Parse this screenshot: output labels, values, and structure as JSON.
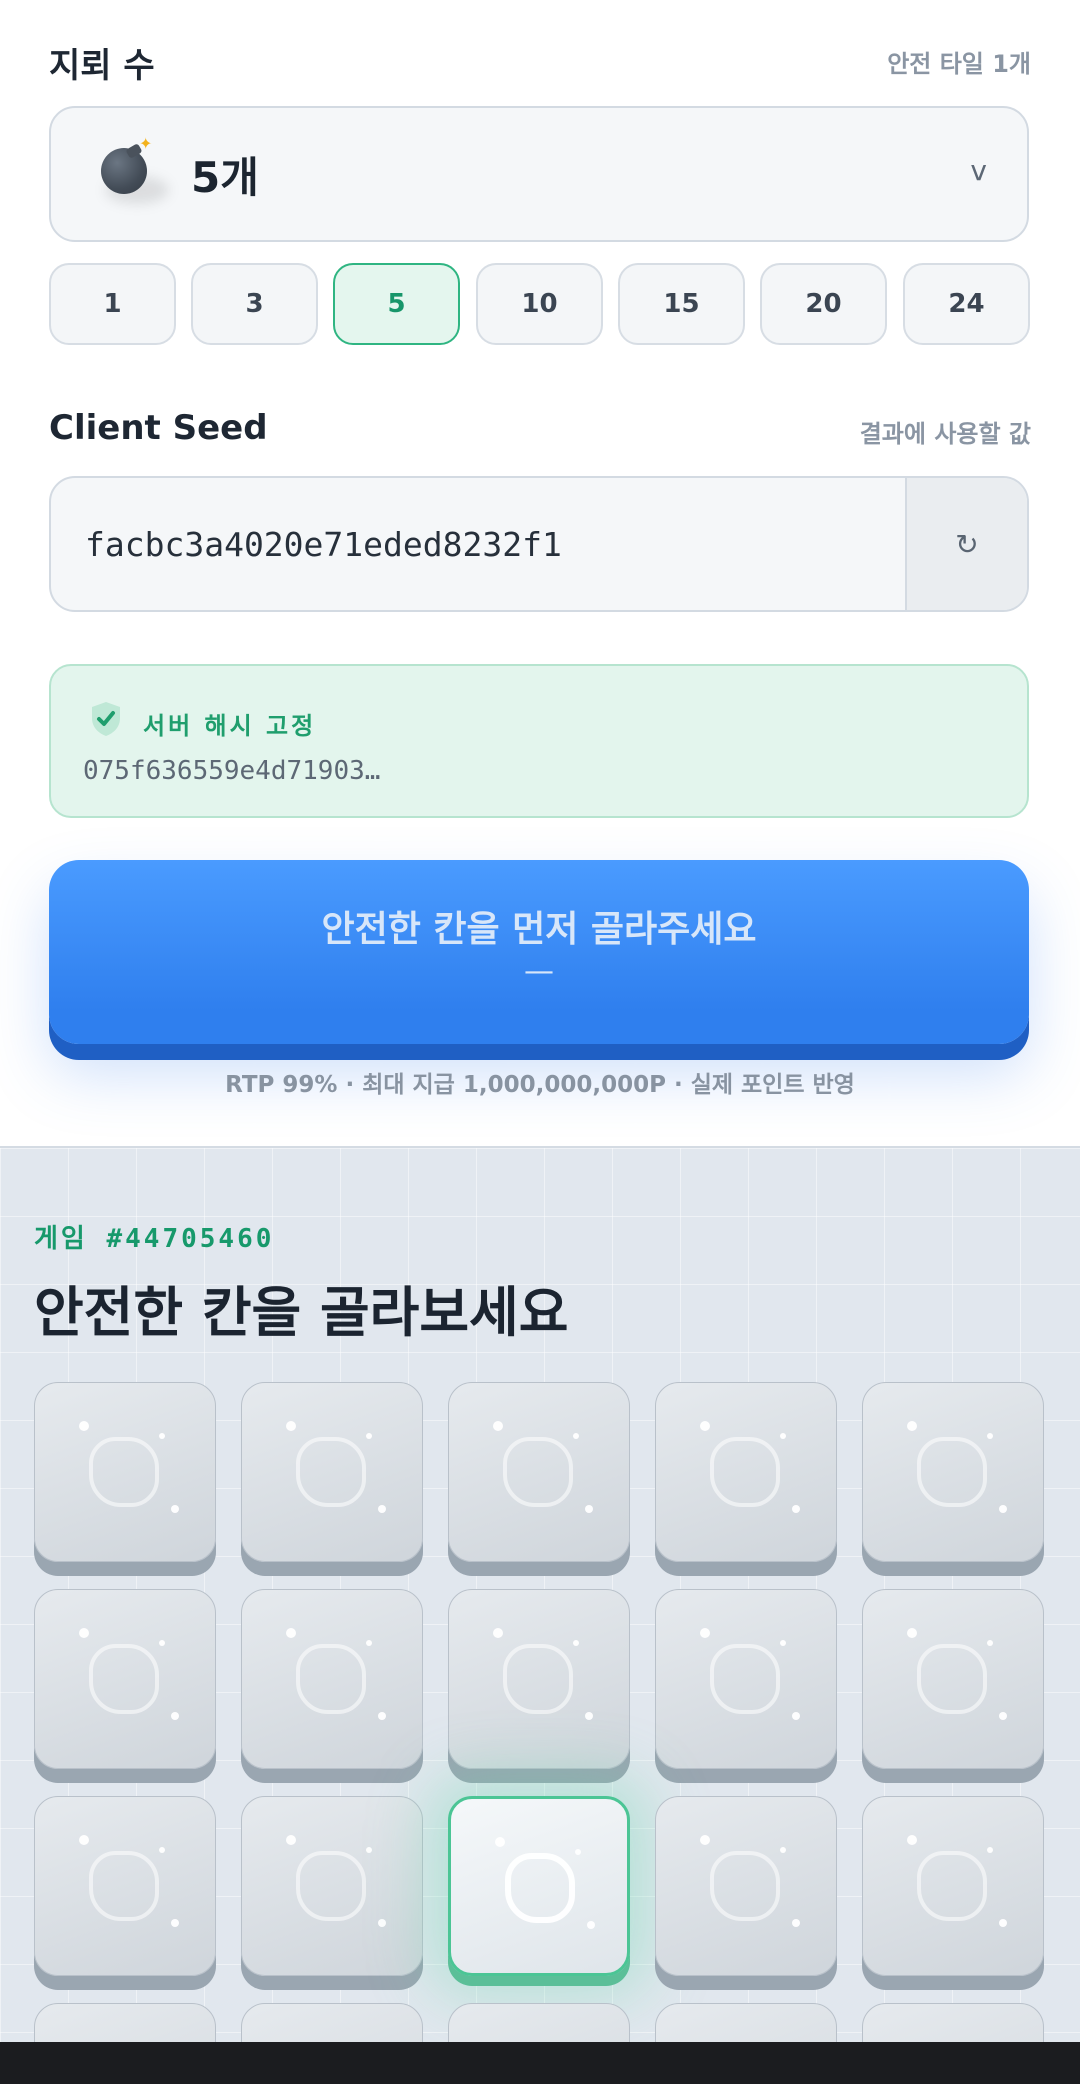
{
  "mines": {
    "title": "지뢰 수",
    "hint": "안전 타일 1개",
    "selected_label": "5개",
    "chevron": "v",
    "icon": "bomb-icon",
    "presets": [
      "1",
      "3",
      "5",
      "10",
      "15",
      "20",
      "24"
    ],
    "active_preset": "5"
  },
  "seed": {
    "title": "Client Seed",
    "hint": "결과에 사용할 값",
    "value": "facbc3a4020e71eded8232f1",
    "refresh_glyph": "↻"
  },
  "server_hash": {
    "label": "서버 해시 고정",
    "value": "075f636559e4d71903…",
    "icon": "shield-check-icon"
  },
  "cta": {
    "label": "안전한 칸을 먼저 골라주세요",
    "sub": "—"
  },
  "rtp_text": "RTP 99% · 최대 지급 1,000,000,000P · 실제 포인트 반영",
  "game": {
    "id_label": "게임 #44705460",
    "title": "안전한 칸을 골라보세요",
    "highlighted_tile": 12
  },
  "colors": {
    "accent_green": "#1f9e6d",
    "accent_blue": "#3a8df8",
    "text_dark": "#1b2430",
    "text_muted": "#8a95a3"
  }
}
